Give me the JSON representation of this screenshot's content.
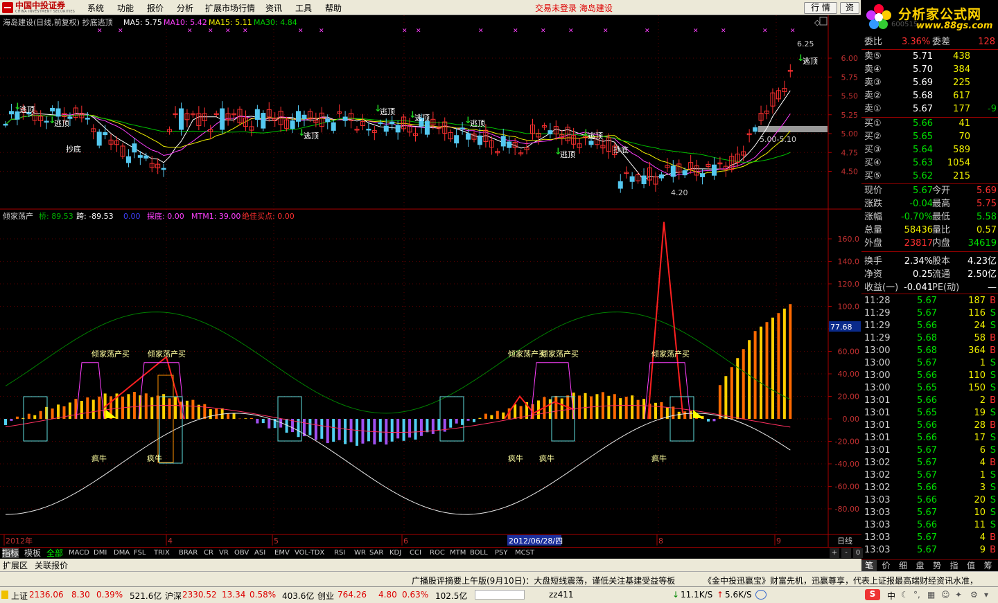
{
  "menubar": {
    "logo_cn": "中国中投证券",
    "logo_en": "CHINA INVESTMENT SECURITIES",
    "items": [
      "系统",
      "功能",
      "报价",
      "分析",
      "扩展市场行情",
      "资讯",
      "工具",
      "帮助"
    ],
    "status_center": "交易未登录 海岛建设",
    "btn_hq": "行 情",
    "btn_zi": "资"
  },
  "brand": {
    "title": "分析家公式网",
    "url": "www.88gs.com",
    "code": "600515"
  },
  "main_chart": {
    "title": "海岛建设(日线,前复权) 抄底逃顶",
    "ma5": "MA5: 5.75",
    "ma10": "MA10: 5.42",
    "ma15": "MA15: 5.11",
    "ma30": "MA30: 4.84",
    "yticks": [
      "6.00",
      "5.75",
      "5.50",
      "5.25",
      "5.00",
      "4.75",
      "4.50"
    ],
    "high_label": "6.25",
    "low_label": "4.20",
    "range_label": "5.00-5.10",
    "signal_top": "逃顶",
    "signal_bottom": "抄底",
    "colors": {
      "up": "#ff3030",
      "down": "#54c8f0",
      "ma5": "#ffffff",
      "ma10": "#ff40ff",
      "ma15": "#f0f000",
      "ma30": "#00c000"
    }
  },
  "ind_chart": {
    "title": "倾家荡产",
    "qiao": "桥: 89.53",
    "kua": "跨: -89.53",
    "zero": "0.00",
    "tandi": "探底: 0.00",
    "mtm": "MTM1: 39.00",
    "jueja": "绝佳买点: 0.00",
    "yticks": [
      "160.0",
      "140.0",
      "120.0",
      "100.0",
      "80.00",
      "60.00",
      "40.00",
      "20.00",
      "0.00",
      "-20.00",
      "-40.00",
      "-60.00",
      "-80.00"
    ],
    "current_value": "77.68",
    "buy_label": "倾家荡产买",
    "bull_label": "疯牛"
  },
  "xaxis": {
    "labels": [
      "2012年",
      "4",
      "5",
      "6",
      "8",
      "9"
    ],
    "cursor_date": "2012/06/28/四",
    "period": "日线"
  },
  "quote": {
    "weibi_label": "委比",
    "weibi": "3.36%",
    "weicha_label": "委差",
    "weicha": "128",
    "sells": [
      {
        "label": "卖⑤",
        "price": "5.71",
        "vol": "438",
        "chg": ""
      },
      {
        "label": "卖④",
        "price": "5.70",
        "vol": "384",
        "chg": ""
      },
      {
        "label": "卖③",
        "price": "5.69",
        "vol": "225",
        "chg": ""
      },
      {
        "label": "卖②",
        "price": "5.68",
        "vol": "617",
        "chg": ""
      },
      {
        "label": "卖①",
        "price": "5.67",
        "vol": "177",
        "chg": "-9"
      }
    ],
    "buys": [
      {
        "label": "买①",
        "price": "5.66",
        "vol": "41"
      },
      {
        "label": "买②",
        "price": "5.65",
        "vol": "70"
      },
      {
        "label": "买③",
        "price": "5.64",
        "vol": "589"
      },
      {
        "label": "买④",
        "price": "5.63",
        "vol": "1054"
      },
      {
        "label": "买⑤",
        "price": "5.62",
        "vol": "215"
      }
    ],
    "stats": [
      [
        "现价",
        "5.67",
        "今开",
        "5.69"
      ],
      [
        "涨跌",
        "-0.04",
        "最高",
        "5.75"
      ],
      [
        "涨幅",
        "-0.70%",
        "最低",
        "5.58"
      ],
      [
        "总量",
        "58436",
        "量比",
        "0.57"
      ],
      [
        "外盘",
        "23817",
        "内盘",
        "34619"
      ],
      [
        "换手",
        "2.34%",
        "股本",
        "4.23亿"
      ],
      [
        "净资",
        "0.25",
        "流通",
        "2.50亿"
      ],
      [
        "收益(一)",
        "-0.041",
        "PE(动)",
        "—"
      ]
    ]
  },
  "ticks": [
    [
      "11:28",
      "5.67",
      "187",
      "B"
    ],
    [
      "11:29",
      "5.67",
      "116",
      "S"
    ],
    [
      "11:29",
      "5.66",
      "24",
      "S"
    ],
    [
      "11:29",
      "5.68",
      "58",
      "B"
    ],
    [
      "13:00",
      "5.68",
      "364",
      "B"
    ],
    [
      "13:00",
      "5.67",
      "1",
      "S"
    ],
    [
      "13:00",
      "5.66",
      "110",
      "S"
    ],
    [
      "13:00",
      "5.65",
      "150",
      "S"
    ],
    [
      "13:01",
      "5.66",
      "2",
      "B"
    ],
    [
      "13:01",
      "5.65",
      "19",
      "S"
    ],
    [
      "13:01",
      "5.66",
      "28",
      "B"
    ],
    [
      "13:01",
      "5.66",
      "17",
      "S"
    ],
    [
      "13:01",
      "5.67",
      "6",
      "S"
    ],
    [
      "13:02",
      "5.67",
      "4",
      "B"
    ],
    [
      "13:02",
      "5.67",
      "1",
      "S"
    ],
    [
      "13:02",
      "5.66",
      "3",
      "S"
    ],
    [
      "13:03",
      "5.66",
      "20",
      "S"
    ],
    [
      "13:03",
      "5.67",
      "10",
      "S"
    ],
    [
      "13:03",
      "5.66",
      "11",
      "S"
    ],
    [
      "13:03",
      "5.67",
      "4",
      "B"
    ],
    [
      "13:03",
      "5.67",
      "9",
      "B"
    ]
  ],
  "right_tabs": [
    "笔",
    "价",
    "细",
    "盘",
    "势",
    "指",
    "值",
    "筹"
  ],
  "ind_tabs": [
    "指标",
    "模板",
    "全部",
    "MACD",
    "DMI",
    "DMA",
    "FSL",
    "TRIX",
    "BRAR",
    "CR",
    "VR",
    "OBV",
    "ASI",
    "EMV",
    "VOL-TDX",
    "RSI",
    "WR",
    "SAR",
    "KDJ",
    "CCI",
    "ROC",
    "MTM",
    "BOLL",
    "PSY",
    "MCST"
  ],
  "ind_ctrl": [
    "+",
    "-",
    "0"
  ],
  "ext_tabs": [
    "扩展区",
    "关联报价"
  ],
  "news": {
    "text1": "广播股评摘要上午版(9月10日)：大盘短线震荡，谨低关注基建受益等板",
    "text2": "《金中投迅赢宝》财富先机，迅赢尊享，代表上证报最高端财经资讯水准，"
  },
  "statusbar": {
    "sh_label": "上证",
    "sh_val": "2136.06",
    "sh_chg": "8.30",
    "sh_pct": "0.39%",
    "sh_amt": "521.6亿",
    "hs_label": "沪深",
    "hs_val": "2330.52",
    "hs_chg": "13.34",
    "hs_pct": "0.58%",
    "hs_amt": "403.6亿",
    "cy_label": "创业",
    "cy_val": "764.26",
    "cy_chg": "4.80",
    "cy_pct": "0.63%",
    "cy_amt": "102.5亿",
    "user": "zz411",
    "net1": "11.1K/S",
    "net2": "5.6K/S",
    "ime": "中"
  }
}
